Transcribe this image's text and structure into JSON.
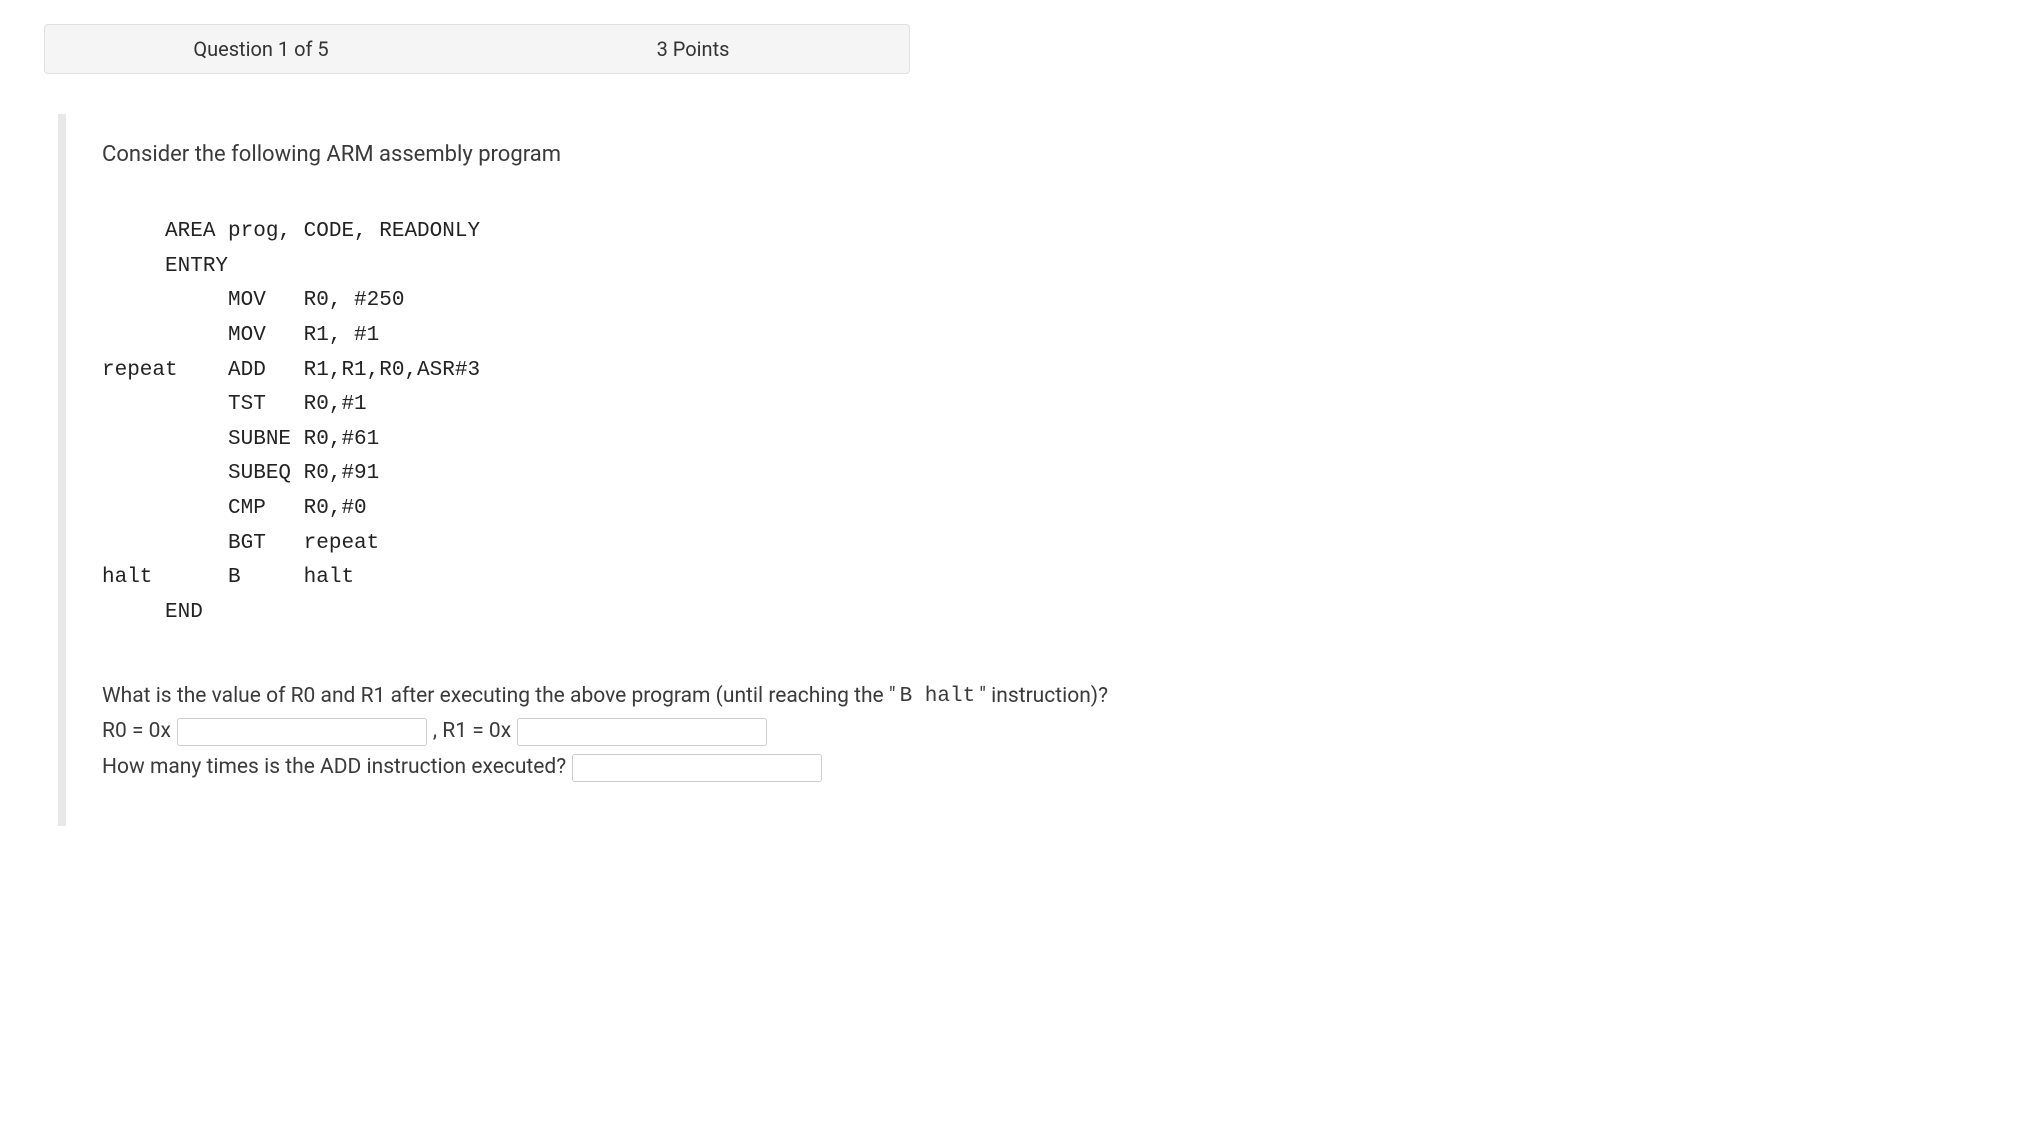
{
  "header": {
    "question_number": "Question 1 of 5",
    "points": "3 Points"
  },
  "content": {
    "intro": "Consider the following ARM assembly program",
    "code": "     AREA prog, CODE, READONLY\n     ENTRY\n          MOV   R0, #250\n          MOV   R1, #1\nrepeat    ADD   R1,R1,R0,ASR#3\n          TST   R0,#1\n          SUBNE R0,#61\n          SUBEQ R0,#91\n          CMP   R0,#0\n          BGT   repeat\nhalt      B     halt\n     END",
    "question_text_1": "What is the value of R0 and R1 after executing the above program (until reaching the  \"",
    "question_text_halt": "B halt",
    "question_text_2": "\" instruction)?",
    "r0_label": "R0 = 0x ",
    "r1_label": ", R1 = 0x ",
    "add_question": "How many times is the ADD instruction executed? "
  }
}
